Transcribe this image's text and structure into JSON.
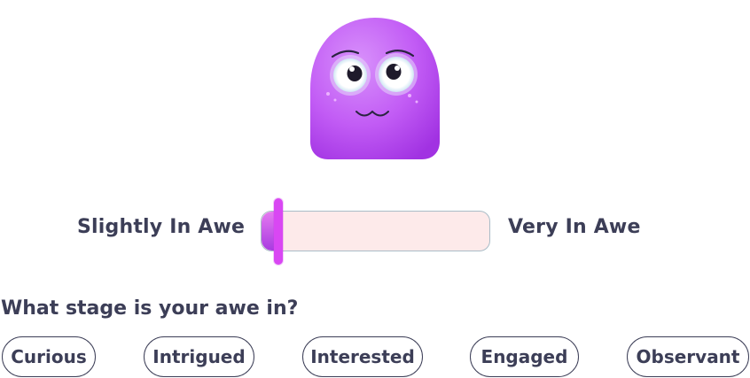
{
  "mascot": {
    "icon": "purple-blob-mascot-icon",
    "body_color": "#c25cf5",
    "body_shade_color": "#a53be6"
  },
  "slider": {
    "min_label": "Slightly In Awe",
    "max_label": "Very In Awe",
    "value_fraction": 0.06,
    "track_color": "#fdeaea",
    "thumb_color": "#d947f3"
  },
  "question": {
    "text": "What stage is your awe in?"
  },
  "options": [
    {
      "label": "Curious"
    },
    {
      "label": "Intrigued"
    },
    {
      "label": "Interested"
    },
    {
      "label": "Engaged"
    },
    {
      "label": "Observant"
    }
  ],
  "colors": {
    "text": "#3c3e57",
    "accent": "#d947f3"
  }
}
